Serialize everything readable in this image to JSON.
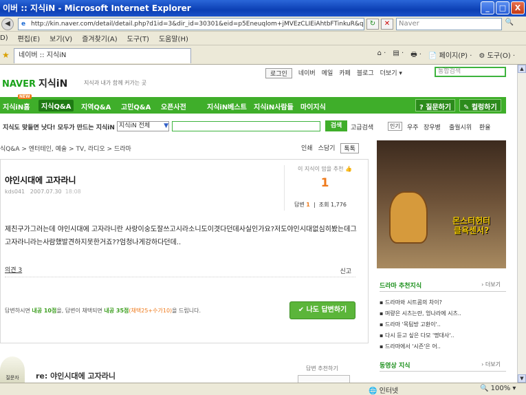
{
  "window": {
    "title": "이버 :: 지식iN - Microsoft Internet Explorer",
    "buttons": {
      "min": "_",
      "max": "□",
      "close": "X"
    }
  },
  "browser": {
    "address": "http://kin.naver.com/detail/detail.php?d1id=3&dir_id=30301&eid=p5Eneuqlom+jMVEzCLIEiAhtbFTinkuR&ql",
    "search_placeholder": "Naver",
    "menu": [
      "D)",
      "편집(E)",
      "보기(V)",
      "즐겨찾기(A)",
      "도구(T)",
      "도움말(H)"
    ],
    "tab_label": "네이버 :: 지식iN",
    "tools": [
      "⌂ ·",
      "▤ ·",
      "🖶 ·",
      "📄 페이지(P) ·",
      "⚙ 도구(O) ·"
    ],
    "status_zone": "인터넷",
    "status_zoom": "100%"
  },
  "header": {
    "logo": "NAVER",
    "logo_service": "지식iN",
    "slogan": "지식과 내가 함께 커가는 곳",
    "links": [
      "로그인",
      "네이버",
      "메일",
      "카페",
      "블로그",
      "더보기 ▾"
    ],
    "search_placeholder": "통합검색"
  },
  "gnav": {
    "items": [
      "지식iN홈",
      "지식Q&A",
      "지역Q&A",
      "고민Q&A",
      "오픈사전",
      "지식iN베스트",
      "지식iN사람들",
      "마이지식"
    ],
    "new_badge": "NEW",
    "ask_button": "? 질문하기",
    "coll_button": "✎ 컬렁하기"
  },
  "searchrow": {
    "tagline": "지식도 맞들면 낫다! 모두가 만드는 지식iN",
    "dropdown": "지식iN 전체",
    "search_button": "검색",
    "advanced": "고급검색",
    "hot_label": "인기",
    "hot_items": [
      "우주",
      "장우병",
      "출월시위",
      "환율"
    ]
  },
  "breadcrumb": {
    "path": "식Q&A > 엔터테인, 예술 > TV, 라디오 > 드라마",
    "actions": [
      "인쇄",
      "스담기",
      "톡톡"
    ]
  },
  "question": {
    "title": "야인시대에 고자라니",
    "author": "kds041",
    "date": "2007.07.30",
    "time": "18:08",
    "rec_label": "이 지식이 맘을 추천",
    "rec_count": "1",
    "answer_label": "답변",
    "answer_count": "1",
    "view_label": "조회",
    "view_count": "1,776",
    "body": "제친구가그러는데 야인시대에 고자라니란 사랑이숭도잘쓰고시라소니도이겻다던데사실인가요?저도야인시대없심히봤는데그고자라니라는사람했발견하지못한거죠??엄청나게강하다던데..",
    "opinion": "의견 3",
    "report": "신고",
    "footer_pre": "답변하시면 ",
    "footer_pts1": "내공 10점",
    "footer_mid": "을, 답변이 채택되면 ",
    "footer_pts2": "내공 35점",
    "footer_paren": "(채택25+수가10)",
    "footer_post": "을 드립니다.",
    "answer_button": "✔ 나도 답변하기"
  },
  "ad": {
    "text": "몬스터헌터\n클욕센서?"
  },
  "sidebar": {
    "drama_title": "드라마 추천지식",
    "more": "› 더보기",
    "drama_items": [
      "드라마와 시트콤의 차이?",
      "며량은 시츠는란, 엉나라에 시츠..",
      "드라마 '목팀방 고환이'..",
      "다시 듣고 싶은 다모 '명대사'..",
      "드라마에서 '시즌'은 어.."
    ],
    "video_title": "동영상 지식",
    "video_more": "› 더보기"
  },
  "answer": {
    "badge": "질문자",
    "title": "re: 야인시대에 고자라니",
    "rec_label": "답변 추천하기"
  }
}
